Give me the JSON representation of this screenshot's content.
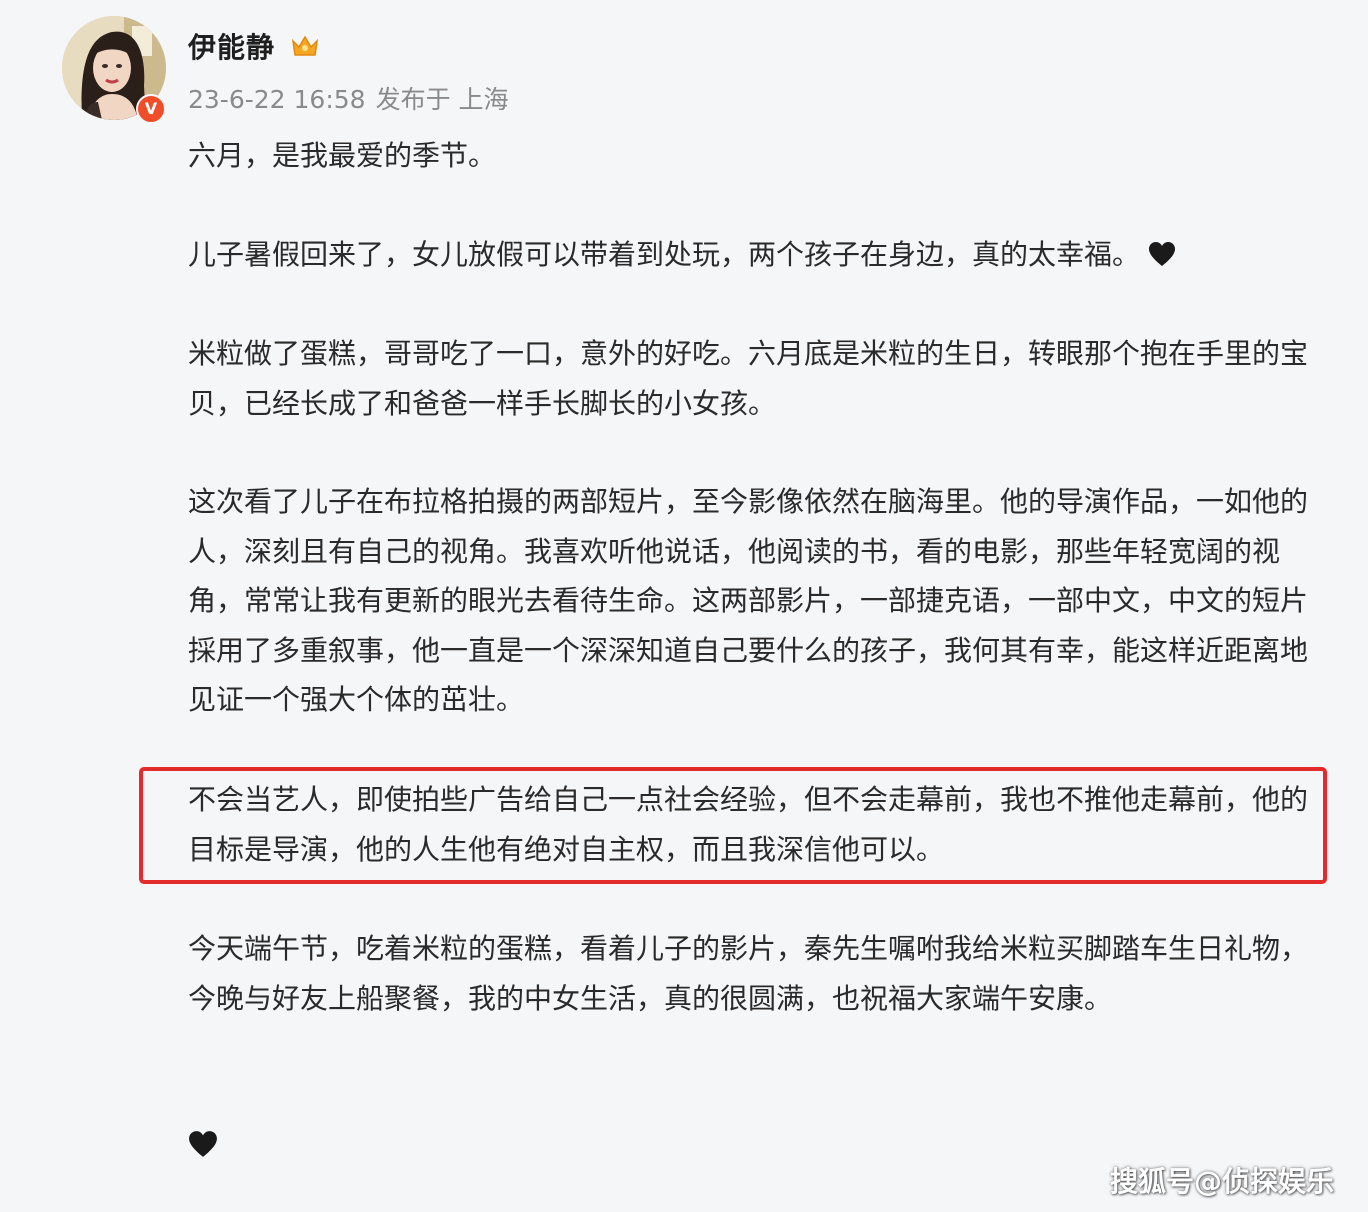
{
  "user": {
    "name": "伊能静",
    "badge": "V"
  },
  "meta": {
    "timestamp": "23-6-22 16:58",
    "location_text": "发布于 上海"
  },
  "post": {
    "p1": "六月，是我最爱的季节。",
    "p2": "儿子暑假回来了，女儿放假可以带着到处玩，两个孩子在身边，真的太幸福。",
    "p3": "米粒做了蛋糕，哥哥吃了一口，意外的好吃。六月底是米粒的生日，转眼那个抱在手里的宝贝，已经长成了和爸爸一样手长脚长的小女孩。",
    "p4": "这次看了儿子在布拉格拍摄的两部短片，至今影像依然在脑海里。他的导演作品，一如他的人，深刻且有自己的视角。我喜欢听他说话，他阅读的书，看的电影，那些年轻宽阔的视角，常常让我有更新的眼光去看待生命。这两部影片，一部捷克语，一部中文，中文的短片採用了多重叙事，他一直是一个深深知道自己要什么的孩子，我何其有幸，能这样近距离地见证一个强大个体的茁壮。",
    "p5": "不会当艺人，即使拍些广告给自己一点社会经验，但不会走幕前，我也不推他走幕前，他的目标是导演，他的人生他有绝对自主权，而且我深信他可以。",
    "p6": "今天端午节，吃着米粒的蛋糕，看着儿子的影片，秦先生嘱咐我给米粒买脚踏车生日礼物，今晚与好友上船聚餐，我的中女生活，真的很圆满，也祝福大家端午安康。"
  },
  "watermark": "搜狐号@侦探娱乐",
  "colors": {
    "highlight_border": "#e32b2b",
    "verified_badge": "#f04e2a",
    "crown": "#f5a623",
    "text": "#2a2a2a",
    "meta_text": "#8a8a8a"
  },
  "icons": [
    "crown-icon",
    "heart-icon",
    "verified-badge"
  ]
}
